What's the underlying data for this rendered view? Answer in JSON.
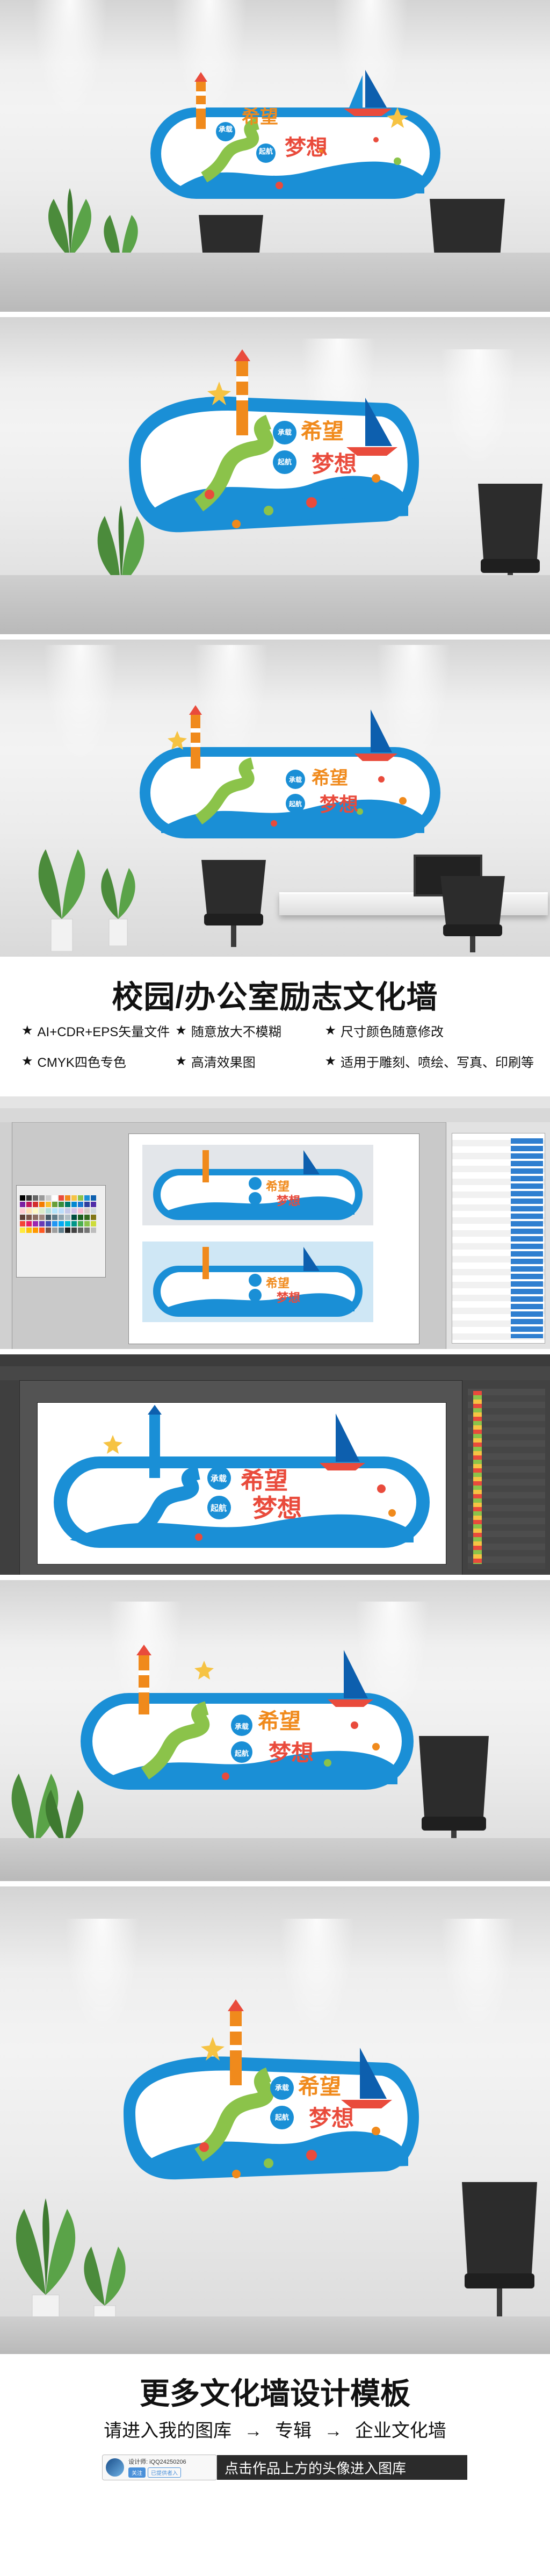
{
  "mural": {
    "line1_left": "承载",
    "line1_right": "希望",
    "line2_left": "起航",
    "line2_right": "梦想"
  },
  "headline": {
    "plain": "校园/办公室",
    "bold": "励志文化墙"
  },
  "features": [
    {
      "icon": "star-icon",
      "label": "AI+CDR+EPS矢量文件"
    },
    {
      "icon": "star-icon",
      "label": "随意放大不模糊"
    },
    {
      "icon": "star-icon",
      "label": "尺寸颜色随意修改"
    },
    {
      "icon": "star-icon",
      "label": "CMYK四色专色"
    },
    {
      "icon": "star-icon",
      "label": "高清效果图"
    },
    {
      "icon": "star-icon",
      "label": "适用于雕刻、喷绘、写真、印刷等"
    }
  ],
  "footer": {
    "title": "更多文化墙设计模板",
    "path_a": "请进入我的图库",
    "arrow": "→",
    "path_b": "专辑",
    "path_c": "企业文化墙",
    "designer_label": "设计师: iQQ24250206",
    "follow_label": "关注",
    "gallery_label": "已提供者入",
    "hint": "点击作品上方的头像进入图库"
  },
  "colors": {
    "blue": "#1a8fd6",
    "deep_blue": "#0d5fae",
    "orange": "#f08a1c",
    "green": "#8bc34a",
    "red": "#e94b3c",
    "yellow": "#f6c343"
  }
}
